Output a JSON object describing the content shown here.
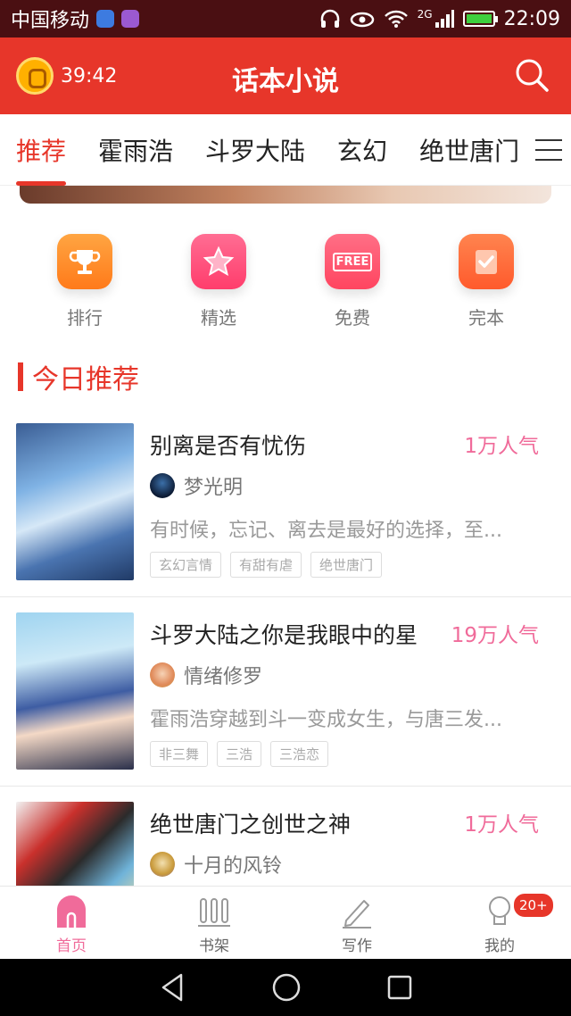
{
  "status_bar": {
    "carrier": "中国移动",
    "network": "2G",
    "time": "22:09"
  },
  "header": {
    "timer": "39:42",
    "title": "话本小说"
  },
  "tabs": [
    {
      "label": "推荐",
      "active": true
    },
    {
      "label": "霍雨浩",
      "active": false
    },
    {
      "label": "斗罗大陆",
      "active": false
    },
    {
      "label": "玄幻",
      "active": false
    },
    {
      "label": "绝世唐门",
      "active": false
    }
  ],
  "categories": [
    {
      "label": "排行",
      "icon": "trophy-icon",
      "color": "#ff8c2a"
    },
    {
      "label": "精选",
      "icon": "star-icon",
      "color": "#ff4f7d"
    },
    {
      "label": "免费",
      "icon": "free-icon",
      "color": "#ff4f6e",
      "icon_text": "FREE"
    },
    {
      "label": "完本",
      "icon": "check-icon",
      "color": "#ff6a3c"
    }
  ],
  "section": {
    "title": "今日推荐"
  },
  "books": [
    {
      "title": "别离是否有忧伤",
      "popularity": "1万人气",
      "author": "梦光明",
      "description": "有时候，忘记、离去是最好的选择，至...",
      "tags": [
        "玄幻言情",
        "有甜有虐",
        "绝世唐门"
      ]
    },
    {
      "title": "斗罗大陆之你是我眼中的星",
      "popularity": "19万人气",
      "author": "情绪修罗",
      "description": "霍雨浩穿越到斗一变成女生，与唐三发...",
      "tags": [
        "非三舞",
        "三浩",
        "三浩恋"
      ]
    },
    {
      "title": "绝世唐门之创世之神",
      "popularity": "1万人气",
      "author": "十月的风铃",
      "description": "",
      "tags": []
    }
  ],
  "bottom_nav": [
    {
      "label": "首页",
      "active": true
    },
    {
      "label": "书架",
      "active": false
    },
    {
      "label": "写作",
      "active": false
    },
    {
      "label": "我的",
      "active": false,
      "badge": "20+"
    }
  ],
  "colors": {
    "brand": "#e7362a",
    "pink": "#f06b9a",
    "status_bar": "#4a0f12"
  }
}
